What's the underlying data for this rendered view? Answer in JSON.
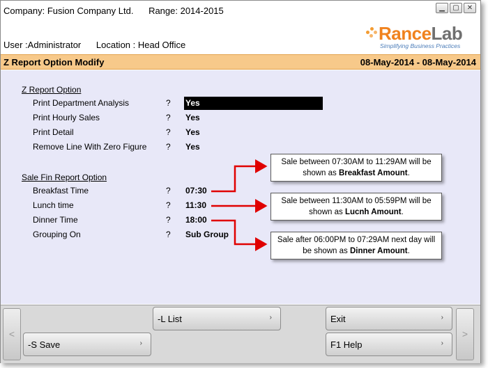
{
  "header": {
    "company": "Company: Fusion Company Ltd.",
    "range": "Range: 2014-2015",
    "user": "User :Administrator",
    "location": "Location : Head Office",
    "window_buttons": [
      "minimize",
      "restore",
      "close"
    ]
  },
  "logo": {
    "brand_part1": "Rance",
    "brand_part2": "Lab",
    "tagline": "Simplifying Business Practices"
  },
  "titlebar": {
    "title": "Z Report Option Modify",
    "date_range": "08-May-2014 - 08-May-2014"
  },
  "z_report": {
    "title": "Z Report Option",
    "rows": [
      {
        "label": "Print Department Analysis",
        "q": "?",
        "value": "Yes"
      },
      {
        "label": "Print Hourly Sales",
        "q": "?",
        "value": "Yes"
      },
      {
        "label": "Print Detail",
        "q": "?",
        "value": "Yes"
      },
      {
        "label": "Remove Line With Zero Figure",
        "q": "?",
        "value": "Yes"
      }
    ]
  },
  "sale_fin": {
    "title": "Sale Fin Report Option",
    "rows": [
      {
        "label": "Breakfast Time",
        "q": "?",
        "value": "07:30"
      },
      {
        "label": "Lunch time",
        "q": "?",
        "value": "11:30"
      },
      {
        "label": "Dinner Time",
        "q": "?",
        "value": "18:00"
      },
      {
        "label": "Grouping On",
        "q": "?",
        "value": "Sub Group"
      }
    ]
  },
  "callouts": [
    {
      "line1": "Sale between 07:30AM to 11:29AM will be",
      "line2_pre": "shown as ",
      "bold": "Breakfast Amount",
      "line2_post": "."
    },
    {
      "line1": "Sale between 11:30AM to 05:59PM will be",
      "line2_pre": "shown as ",
      "bold": "Lucnh Amount",
      "line2_post": "."
    },
    {
      "line1": "Sale after 06:00PM to 07:29AM next day will",
      "line2_pre": "be shown as ",
      "bold": "Dinner Amount",
      "line2_post": "."
    }
  ],
  "footer": {
    "list": "-L List",
    "save": "-S Save",
    "exit": "Exit",
    "help": "F1 Help",
    "prev": "<",
    "next": ">",
    "chevron": "›"
  },
  "colors": {
    "titlebar_bg": "#f7c98a",
    "panel_bg": "#e8e8f8",
    "arrow": "#e00000",
    "brand_orange": "#f0821e"
  }
}
